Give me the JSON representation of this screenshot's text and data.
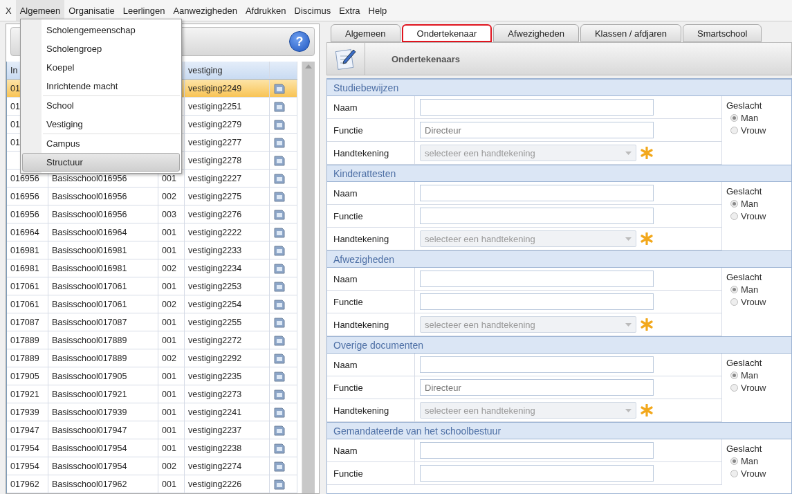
{
  "menubar": [
    {
      "label": "X",
      "open": false
    },
    {
      "label": "Algemeen",
      "open": true
    },
    {
      "label": "Organisatie",
      "open": false
    },
    {
      "label": "Leerlingen",
      "open": false
    },
    {
      "label": "Aanwezigheden",
      "open": false
    },
    {
      "label": "Afdrukken",
      "open": false
    },
    {
      "label": "Discimus",
      "open": false
    },
    {
      "label": "Extra",
      "open": false
    },
    {
      "label": "Help",
      "open": false
    }
  ],
  "dropdown": {
    "groups": [
      [
        {
          "label": "Scholengemeenschap",
          "selected": false
        },
        {
          "label": "Scholengroep",
          "selected": false
        },
        {
          "label": "Koepel",
          "selected": false
        },
        {
          "label": "Inrichtende macht",
          "selected": false
        }
      ],
      [
        {
          "label": "School",
          "selected": false
        },
        {
          "label": "Vestiging",
          "selected": false
        }
      ],
      [
        {
          "label": "Campus",
          "selected": false
        },
        {
          "label": "Structuur",
          "selected": true
        }
      ]
    ]
  },
  "help": {
    "label": "?"
  },
  "table": {
    "columns": [
      "In",
      "",
      "",
      "vestiging"
    ],
    "rows": [
      {
        "cells": [
          "01",
          "",
          "",
          "vestiging2249"
        ],
        "selected": true
      },
      {
        "cells": [
          "01",
          "",
          "",
          "vestiging2251"
        ],
        "selected": false
      },
      {
        "cells": [
          "01",
          "",
          "",
          "vestiging2279"
        ],
        "selected": false
      },
      {
        "cells": [
          "01",
          "",
          "",
          "vestiging2277"
        ],
        "selected": false
      },
      {
        "cells": [
          "",
          "",
          "",
          "vestiging2278"
        ],
        "selected": false
      },
      {
        "cells": [
          "016956",
          "Basisschool016956",
          "001",
          "vestiging2227"
        ],
        "selected": false
      },
      {
        "cells": [
          "016956",
          "Basisschool016956",
          "002",
          "vestiging2275"
        ],
        "selected": false
      },
      {
        "cells": [
          "016956",
          "Basisschool016956",
          "003",
          "vestiging2276"
        ],
        "selected": false
      },
      {
        "cells": [
          "016964",
          "Basisschool016964",
          "001",
          "vestiging2222"
        ],
        "selected": false
      },
      {
        "cells": [
          "016981",
          "Basisschool016981",
          "001",
          "vestiging2233"
        ],
        "selected": false
      },
      {
        "cells": [
          "016981",
          "Basisschool016981",
          "002",
          "vestiging2234"
        ],
        "selected": false
      },
      {
        "cells": [
          "017061",
          "Basisschool017061",
          "001",
          "vestiging2253"
        ],
        "selected": false
      },
      {
        "cells": [
          "017061",
          "Basisschool017061",
          "002",
          "vestiging2254"
        ],
        "selected": false
      },
      {
        "cells": [
          "017087",
          "Basisschool017087",
          "001",
          "vestiging2255"
        ],
        "selected": false
      },
      {
        "cells": [
          "017889",
          "Basisschool017889",
          "001",
          "vestiging2272"
        ],
        "selected": false
      },
      {
        "cells": [
          "017889",
          "Basisschool017889",
          "002",
          "vestiging2292"
        ],
        "selected": false
      },
      {
        "cells": [
          "017905",
          "Basisschool017905",
          "001",
          "vestiging2235"
        ],
        "selected": false
      },
      {
        "cells": [
          "017921",
          "Basisschool017921",
          "001",
          "vestiging2273"
        ],
        "selected": false
      },
      {
        "cells": [
          "017939",
          "Basisschool017939",
          "001",
          "vestiging2241"
        ],
        "selected": false
      },
      {
        "cells": [
          "017947",
          "Basisschool017947",
          "001",
          "vestiging2237"
        ],
        "selected": false
      },
      {
        "cells": [
          "017954",
          "Basisschool017954",
          "001",
          "vestiging2238"
        ],
        "selected": false
      },
      {
        "cells": [
          "017954",
          "Basisschool017954",
          "002",
          "vestiging2274"
        ],
        "selected": false
      },
      {
        "cells": [
          "017962",
          "Basisschool017962",
          "001",
          "vestiging2226"
        ],
        "selected": false
      }
    ]
  },
  "tabs": [
    {
      "label": "Algemeen",
      "selected": false
    },
    {
      "label": "Ondertekenaar",
      "selected": true
    },
    {
      "label": "Afwezigheden",
      "selected": false
    },
    {
      "label": "Klassen / afdjaren",
      "selected": false
    },
    {
      "label": "Smartschool",
      "selected": false
    }
  ],
  "toolbar": {
    "title": "Ondertekenaars"
  },
  "sections": [
    {
      "title": "Studiebewijzen",
      "fields": [
        {
          "label": "Naam",
          "kind": "text"
        },
        {
          "label": "Functie",
          "kind": "text",
          "value": "Directeur"
        },
        {
          "label": "Handtekening",
          "kind": "select",
          "placeholder": "selecteer een handtekening",
          "disabled": true
        }
      ],
      "gender": {
        "label": "Geslacht",
        "options": [
          {
            "label": "Man",
            "selected": true
          },
          {
            "label": "Vrouw",
            "selected": false
          }
        ]
      }
    },
    {
      "title": "Kinderattesten",
      "fields": [
        {
          "label": "Naam",
          "kind": "text"
        },
        {
          "label": "Functie",
          "kind": "text"
        },
        {
          "label": "Handtekening",
          "kind": "select",
          "placeholder": "selecteer een handtekening",
          "disabled": true
        }
      ],
      "gender": {
        "label": "Geslacht",
        "options": [
          {
            "label": "Man",
            "selected": true
          },
          {
            "label": "Vrouw",
            "selected": false
          }
        ]
      }
    },
    {
      "title": "Afwezigheden",
      "fields": [
        {
          "label": "Naam",
          "kind": "text"
        },
        {
          "label": "Functie",
          "kind": "text"
        },
        {
          "label": "Handtekening",
          "kind": "select",
          "placeholder": "selecteer een handtekening",
          "disabled": true
        }
      ],
      "gender": {
        "label": "Geslacht",
        "options": [
          {
            "label": "Man",
            "selected": true
          },
          {
            "label": "Vrouw",
            "selected": false
          }
        ]
      }
    },
    {
      "title": "Overige documenten",
      "fields": [
        {
          "label": "Naam",
          "kind": "text"
        },
        {
          "label": "Functie",
          "kind": "text",
          "value": "Directeur"
        },
        {
          "label": "Handtekening",
          "kind": "select",
          "placeholder": "selecteer een handtekening",
          "disabled": true
        }
      ],
      "gender": {
        "label": "Geslacht",
        "options": [
          {
            "label": "Man",
            "selected": true
          },
          {
            "label": "Vrouw",
            "selected": false
          }
        ]
      }
    },
    {
      "title": "Gemandateerde van het schoolbestuur",
      "fields": [
        {
          "label": "Naam",
          "kind": "text"
        },
        {
          "label": "Functie",
          "kind": "text"
        }
      ],
      "gender": {
        "label": "Geslacht",
        "options": [
          {
            "label": "Man",
            "selected": true
          },
          {
            "label": "Vrouw",
            "selected": false
          }
        ]
      }
    }
  ]
}
